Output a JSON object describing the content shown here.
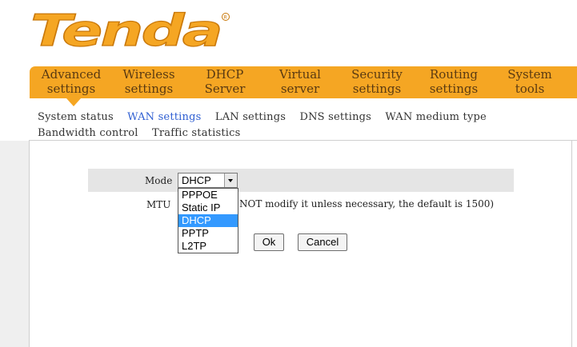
{
  "brand": {
    "logo_text": "Tenda"
  },
  "colors": {
    "nav_bg": "#f5a623",
    "nav_text": "#5a3a12",
    "active_link": "#2e5ed2",
    "option_selected": "#3399ff"
  },
  "topnav": [
    {
      "line1": "Advanced",
      "line2": "settings"
    },
    {
      "line1": "Wireless",
      "line2": "settings"
    },
    {
      "line1": "DHCP",
      "line2": "Server"
    },
    {
      "line1": "Virtual",
      "line2": "server"
    },
    {
      "line1": "Security",
      "line2": "settings"
    },
    {
      "line1": "Routing",
      "line2": "settings"
    },
    {
      "line1": "System",
      "line2": "tools"
    }
  ],
  "subnav": [
    {
      "label": "System status",
      "active": false
    },
    {
      "label": "WAN settings",
      "active": true
    },
    {
      "label": "LAN settings",
      "active": false
    },
    {
      "label": "DNS settings",
      "active": false
    },
    {
      "label": "WAN medium type",
      "active": false
    },
    {
      "label": "Bandwidth control",
      "active": false
    },
    {
      "label": "Traffic statistics",
      "active": false
    }
  ],
  "form": {
    "mode_label": "Mode",
    "mode_value": "DHCP",
    "mode_options": [
      "PPPOE",
      "Static IP",
      "DHCP",
      "PPTP",
      "L2TP"
    ],
    "mtu_label": "MTU",
    "mtu_note": "NOT modify it unless necessary, the default is 1500)",
    "ok_label": "Ok",
    "cancel_label": "Cancel"
  }
}
